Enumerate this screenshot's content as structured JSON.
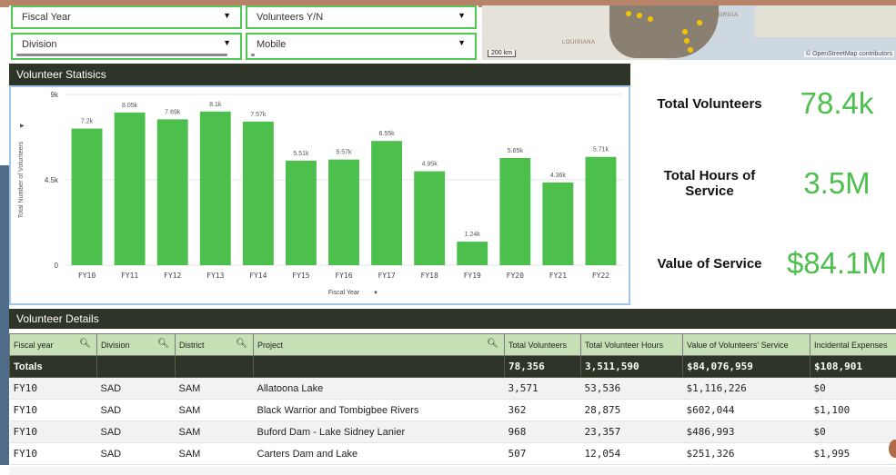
{
  "filters": [
    {
      "label": "Fiscal Year"
    },
    {
      "label": "Volunteers Y/N"
    },
    {
      "label": "Division"
    },
    {
      "label": "Mobile"
    }
  ],
  "map": {
    "labels": [
      "LOUISIANA",
      "GEORGIA"
    ],
    "scale": "200 km",
    "attribution": "© OpenStreetMap contributors"
  },
  "stats": {
    "title": "Volunteer Statisics"
  },
  "chart_data": {
    "type": "bar",
    "color": "#4cbf4c",
    "categories": [
      "FY10",
      "FY11",
      "FY12",
      "FY13",
      "FY14",
      "FY15",
      "FY16",
      "FY17",
      "FY18",
      "FY19",
      "FY20",
      "FY21",
      "FY22"
    ],
    "values": [
      7.2,
      8.05,
      7.69,
      8.1,
      7.57,
      5.51,
      5.57,
      6.55,
      4.95,
      1.24,
      5.65,
      4.36,
      5.71
    ],
    "data_labels": [
      "7.2k",
      "8.05k",
      "7.69k",
      "8.1k",
      "7.57k",
      "5.51k",
      "5.57k",
      "6.55k",
      "4.95k",
      "1.24k",
      "5.65k",
      "4.36k",
      "5.71k"
    ],
    "yticks": [
      "0",
      "4.5k",
      "9k"
    ],
    "ylim": [
      0,
      9
    ],
    "ylabel": "Total Number of Volunteers",
    "xlabel": "Fiscal Year"
  },
  "kpis": [
    {
      "label": "Total Volunteers",
      "value": "78.4k"
    },
    {
      "label": "Total Hours of Service",
      "value": "3.5M"
    },
    {
      "label": "Value of Service",
      "value": "$84.1M"
    }
  ],
  "details": {
    "title": "Volunteer Details",
    "columns": [
      "Fiscal year",
      "Division",
      "District",
      "Project",
      "Total Volunteers",
      "Total Volunteer Hours",
      "Value of Volunteers' Service",
      "Incidental Expenses"
    ],
    "totals": [
      "Totals",
      "",
      "",
      "",
      "78,356",
      "3,511,590",
      "$84,076,959",
      "$108,901"
    ],
    "rows": [
      [
        "FY10",
        "SAD",
        "SAM",
        "Allatoona Lake",
        "3,571",
        "53,536",
        "$1,116,226",
        "$0"
      ],
      [
        "FY10",
        "SAD",
        "SAM",
        "Black Warrior and Tombigbee Rivers",
        "362",
        "28,875",
        "$602,044",
        "$1,100"
      ],
      [
        "FY10",
        "SAD",
        "SAM",
        "Buford Dam - Lake Sidney Lanier",
        "968",
        "23,357",
        "$486,993",
        "$0"
      ],
      [
        "FY10",
        "SAD",
        "SAM",
        "Carters Dam and Lake",
        "507",
        "12,054",
        "$251,326",
        "$1,995"
      ]
    ]
  }
}
